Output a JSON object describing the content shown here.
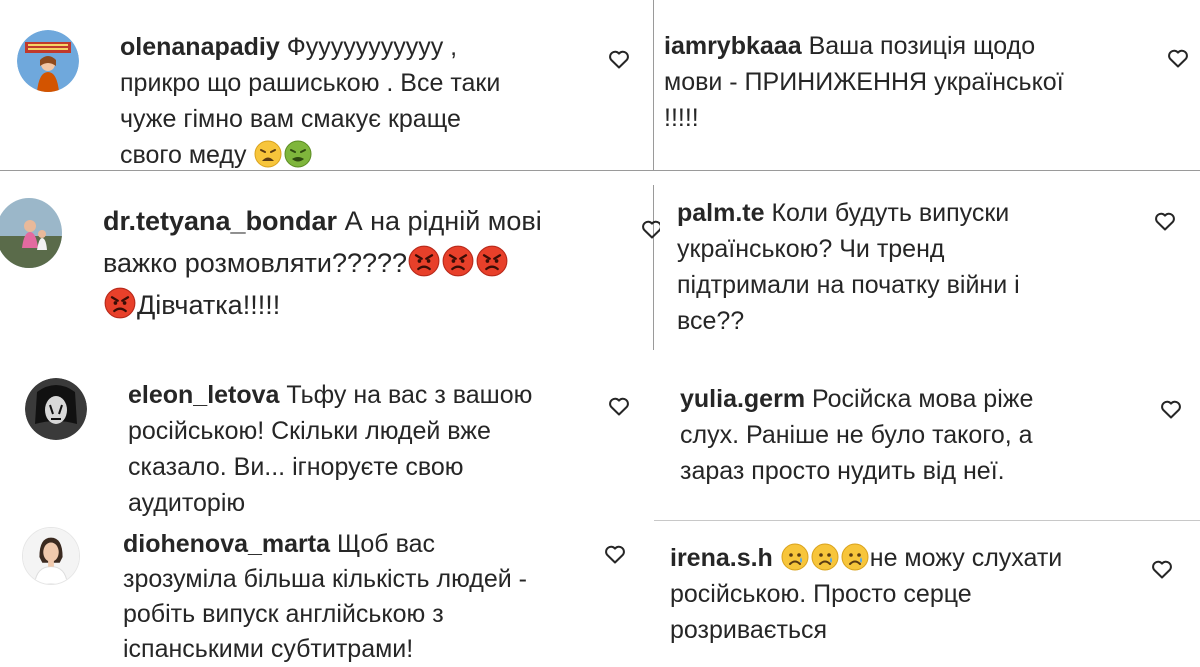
{
  "comments": [
    {
      "username": "olenanapadiy",
      "avatar_icon": "avatar-poster-icon",
      "lines": [
        "Фууууууууууу ,",
        "прикро що рашиською . Все таки",
        "чуже гімно вам смакує краще",
        "свого меду"
      ],
      "emojis": [
        "weary-face",
        "nauseated-face"
      ]
    },
    {
      "username": "iamrybkaaa",
      "lines": [
        "Ваша позиція щодо",
        "мови - ПРИНИЖЕННЯ української",
        "!!!!!"
      ]
    },
    {
      "username": "dr.tetyana_bondar",
      "avatar_icon": "avatar-photo-icon",
      "lines": [
        "А на рідній мові",
        "важко розмовляти?????",
        "Дівчатка!!!!!"
      ],
      "emojis": [
        "angry-face",
        "angry-face",
        "angry-face",
        "angry-face"
      ]
    },
    {
      "username": "palm.te",
      "lines": [
        "Коли будуть випуски",
        "українською? Чи тренд",
        "підтримали на початку війни і",
        "все??"
      ]
    },
    {
      "username": "eleon_letova",
      "avatar_icon": "avatar-dark-portrait-icon",
      "lines": [
        "Тьфу на вас з вашою",
        "російською! Скільки людей вже",
        "сказало. Ви... ігноруєте свою",
        "аудиторію"
      ]
    },
    {
      "username": "yulia.germ",
      "lines": [
        "Російска мова ріже",
        "слух. Раніше не було такого, а",
        "зараз просто нудить від неї."
      ]
    },
    {
      "username": "diohenova_marta",
      "avatar_icon": "avatar-woman-portrait-icon",
      "lines": [
        "Щоб вас",
        "зрозуміла більша кількість людей -",
        "робіть випуск англійською з",
        "іспанськими субтитрами!"
      ]
    },
    {
      "username": "irena.s.h",
      "lines": [
        "не можу слухати",
        "російською. Просто серце",
        "розривається"
      ],
      "emojis": [
        "crying-face",
        "crying-face",
        "crying-face"
      ]
    }
  ],
  "icons": {
    "like": "heart-outline-icon"
  },
  "colors": {
    "text": "#262626",
    "divider": "#9a9a9a",
    "emoji_yellow": "#f7c53b",
    "emoji_angry": "#e8402a"
  }
}
